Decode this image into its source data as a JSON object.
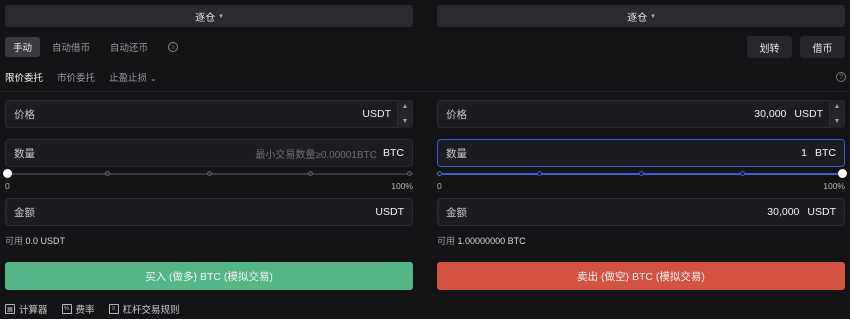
{
  "left_panel": {
    "mode_select": {
      "label": "逐仓",
      "caret": "▾"
    },
    "order_modes": [
      "手动",
      "自动借币",
      "自动还币"
    ],
    "order_types": [
      "限价委托",
      "市价委托",
      "止盈止损"
    ],
    "price": {
      "label": "价格",
      "value": "",
      "unit": "USDT"
    },
    "amount": {
      "label": "数量",
      "placeholder": "最小交易数量≥0.00001BTC",
      "unit": "BTC"
    },
    "slider": {
      "min_label": "0",
      "max_label": "100%",
      "percent": 0
    },
    "total": {
      "label": "金额",
      "value": "",
      "unit": "USDT"
    },
    "available": {
      "label": "可用",
      "value": "0.0 USDT"
    },
    "buy_button": "买入 (做多) BTC (模拟交易)"
  },
  "right_panel": {
    "mode_select": {
      "label": "逐仓",
      "caret": "▾"
    },
    "transfer_button": "划转",
    "borrow_button": "借币",
    "price": {
      "label": "价格",
      "value": "30,000",
      "unit": "USDT"
    },
    "amount": {
      "label": "数量",
      "value": "1",
      "unit": "BTC"
    },
    "slider": {
      "min_label": "0",
      "max_label": "100%",
      "percent": 100
    },
    "total": {
      "label": "金额",
      "value": "30,000",
      "unit": "USDT"
    },
    "available": {
      "label": "可用",
      "value": "1.00000000 BTC"
    },
    "sell_button": "卖出 (做空) BTC (模拟交易)"
  },
  "footer": {
    "calculator": "计算器",
    "fees": "费率",
    "rules": "杠杆交易规则"
  },
  "colors": {
    "buy": "#54b587",
    "sell": "#d35343",
    "focus": "#3f5bd8",
    "background": "#141416"
  },
  "icons": [
    "chevron-down-icon",
    "info-icon",
    "help-icon",
    "stepper-up-icon",
    "stepper-down-icon",
    "calculator-icon",
    "fee-icon",
    "rules-icon"
  ]
}
